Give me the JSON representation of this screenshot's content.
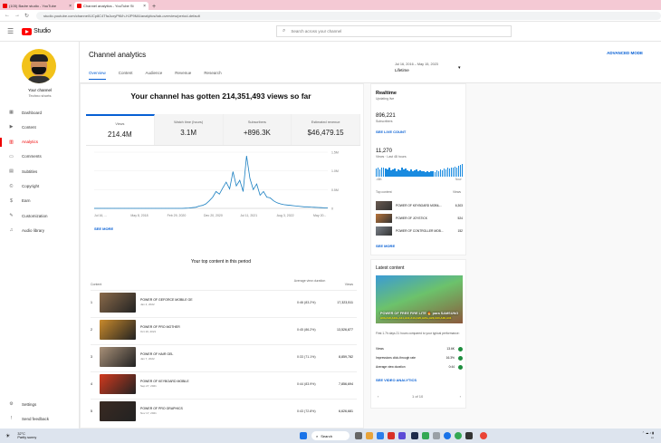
{
  "browser": {
    "tabs": [
      {
        "label": "(105) Badre studio - YouTube",
        "active": false
      },
      {
        "label": "Channel analytics - YouTube St",
        "active": true
      }
    ],
    "url": "studio.youtube.com/channel/UCp8C4TfaJuxyPf6/h-HJP9MA/analytics/tab-overview/period-default"
  },
  "topbar": {
    "logo": "Studio",
    "search_placeholder": "Search across your channel"
  },
  "sidebar": {
    "channel_name": "Your channel",
    "channel_sub": "Techno shorts",
    "items": [
      {
        "label": "Dashboard",
        "icon": "dashboard-icon",
        "active": false
      },
      {
        "label": "Content",
        "icon": "content-icon",
        "active": false
      },
      {
        "label": "Analytics",
        "icon": "analytics-icon",
        "active": true
      },
      {
        "label": "Comments",
        "icon": "comments-icon",
        "active": false
      },
      {
        "label": "Subtitles",
        "icon": "subtitles-icon",
        "active": false
      },
      {
        "label": "Copyright",
        "icon": "copyright-icon",
        "active": false
      },
      {
        "label": "Earn",
        "icon": "earn-icon",
        "active": false
      },
      {
        "label": "Customization",
        "icon": "customization-icon",
        "active": false
      },
      {
        "label": "Audio library",
        "icon": "audio-library-icon",
        "active": false
      }
    ],
    "bottom": [
      {
        "label": "Settings",
        "icon": "settings-icon"
      },
      {
        "label": "Send feedback",
        "icon": "feedback-icon"
      }
    ]
  },
  "header": {
    "title": "Channel analytics",
    "advanced_mode": "ADVANCED MODE",
    "tabs": [
      "Overview",
      "Content",
      "Audience",
      "Revenue",
      "Research"
    ],
    "date_range": "Jul 16, 2016 – May 15, 2023",
    "date_selected": "Lifetime"
  },
  "overview": {
    "headline": "Your channel has gotten 214,351,493 views so far",
    "metrics": [
      {
        "label": "Views",
        "value": "214.4M"
      },
      {
        "label": "Watch time (hours)",
        "value": "3.1M"
      },
      {
        "label": "Subscribers",
        "value": "+896.3K"
      },
      {
        "label": "Estimated revenue",
        "value": "$46,479.15"
      }
    ],
    "see_more": "SEE MORE"
  },
  "chart_data": {
    "type": "line",
    "x_ticks": [
      "Jul 16, ...",
      "May 8, 2018",
      "Feb 29, 2020",
      "Dec 20, 2020",
      "Jul 11, 2021",
      "Aug 3, 2022",
      "May 20..."
    ],
    "y_ticks": [
      "1.5M",
      "1.0M",
      "0.5M",
      "0"
    ],
    "ylim": [
      0,
      1500000
    ],
    "series": [
      {
        "values": [
          0,
          0,
          0,
          0,
          0,
          0,
          0,
          0,
          0,
          0,
          0,
          0,
          0,
          0,
          0,
          0,
          0,
          0,
          0,
          0,
          0,
          0,
          0,
          0,
          0,
          0,
          0,
          5000,
          10000,
          20000,
          30000,
          60000,
          80000,
          120000,
          200000,
          300000,
          450000,
          380000,
          550000,
          700000,
          520000,
          980000,
          600000,
          750000,
          450000,
          1400000,
          800000,
          500000,
          650000,
          350000,
          450000,
          300000,
          280000,
          200000,
          150000,
          120000,
          100000,
          90000,
          80000,
          70000,
          60000,
          50000,
          40000,
          40000,
          35000,
          30000,
          25000,
          20000,
          15000,
          10000
        ]
      }
    ]
  },
  "top_content": {
    "title": "Your top content in this period",
    "col_content": "Content",
    "col_avd": "Average view duration",
    "col_views": "Views",
    "rows": [
      {
        "rank": "1",
        "title": "POWER OF GEFORCE MOBILE GE",
        "date": "Jan 4, 2022",
        "avd": "0:46 (83.2%)",
        "views": "17,323,511",
        "thumb": "#8a6a4a"
      },
      {
        "rank": "2",
        "title": "POWER OF PRO MOTHER",
        "date": "Oct 19, 2021",
        "avd": "0:45 (86.2%)",
        "views": "13,526,877",
        "thumb": "#c98a2c"
      },
      {
        "rank": "3",
        "title": "POWER OF HAIR GEL",
        "date": "Jan 7, 2022",
        "avd": "0:33 (71.1%)",
        "views": "8,859,782",
        "thumb": "#a89078"
      },
      {
        "rank": "4",
        "title": "POWER OF KEYBOARD MOBILE",
        "date": "Sep 27, 2021",
        "avd": "0:44 (83.9%)",
        "views": "7,856,694",
        "thumb": "#d23a1e"
      },
      {
        "rank": "5",
        "title": "POWER OF PRO GRAPHICS",
        "date": "Nov 17, 2021",
        "avd": "0:43 (72.8%)",
        "views": "6,626,681",
        "thumb": "#3a2a22"
      }
    ]
  },
  "realtime": {
    "title": "Realtime",
    "updating": "Updating live",
    "subscribers": "896,221",
    "subscribers_label": "Subscribers",
    "see_live_count": "SEE LIVE COUNT",
    "views": "11,270",
    "views_label": "Views · Last 48 hours",
    "bars": [
      0.55,
      0.6,
      0.5,
      0.65,
      0.6,
      0.55,
      0.5,
      0.6,
      0.45,
      0.5,
      0.55,
      0.4,
      0.5,
      0.45,
      0.6,
      0.5,
      0.55,
      0.45,
      0.4,
      0.5,
      0.35,
      0.45,
      0.5,
      0.4,
      0.45,
      0.35,
      0.4,
      0.3,
      0.35,
      0.3,
      0.4,
      0.35,
      0.3,
      0.45,
      0.4,
      0.5,
      0.45,
      0.55,
      0.5,
      0.6,
      0.55,
      0.65,
      0.6,
      0.7,
      0.65,
      0.75,
      0.8,
      0.85
    ],
    "axis_left": "-48h",
    "axis_right": "Now",
    "top_content_label": "Top content",
    "views_col": "Views",
    "items": [
      {
        "name": "POWER OF KEYBOARD MOBIL...",
        "views": "6,303",
        "thumb": "#6a5a50"
      },
      {
        "name": "POWER OF JOYSTICK",
        "views": "524",
        "thumb": "#b8743a"
      },
      {
        "name": "POWER OF CONTROLLER MOB...",
        "views": "152",
        "thumb": "#7a8088"
      }
    ],
    "see_more": "SEE MORE"
  },
  "latest": {
    "title": "Latest content",
    "caption": "POWER OF FREE FIRE LITE 🔥 para SAMSUNG",
    "caption2": "A03,A10,A10s,A11,A12,A13,A20,A21s,A22,A23,A30,A31",
    "note": "First 1.7h days 21 hours compared to your typical performance:",
    "rows": [
      {
        "label": "Views",
        "value": "13.6K",
        "dot": "#1e8e3e"
      },
      {
        "label": "Impressions click-through rate",
        "value": "16.3%",
        "dot": "#1e8e3e"
      },
      {
        "label": "Average view duration",
        "value": "0:44",
        "dot": "#1e8e3e"
      }
    ],
    "see_analytics": "SEE VIDEO ANALYTICS",
    "pager": "1 of 10"
  },
  "taskbar": {
    "temp": "32°C",
    "weather": "Partly sunny",
    "search": "Search"
  }
}
